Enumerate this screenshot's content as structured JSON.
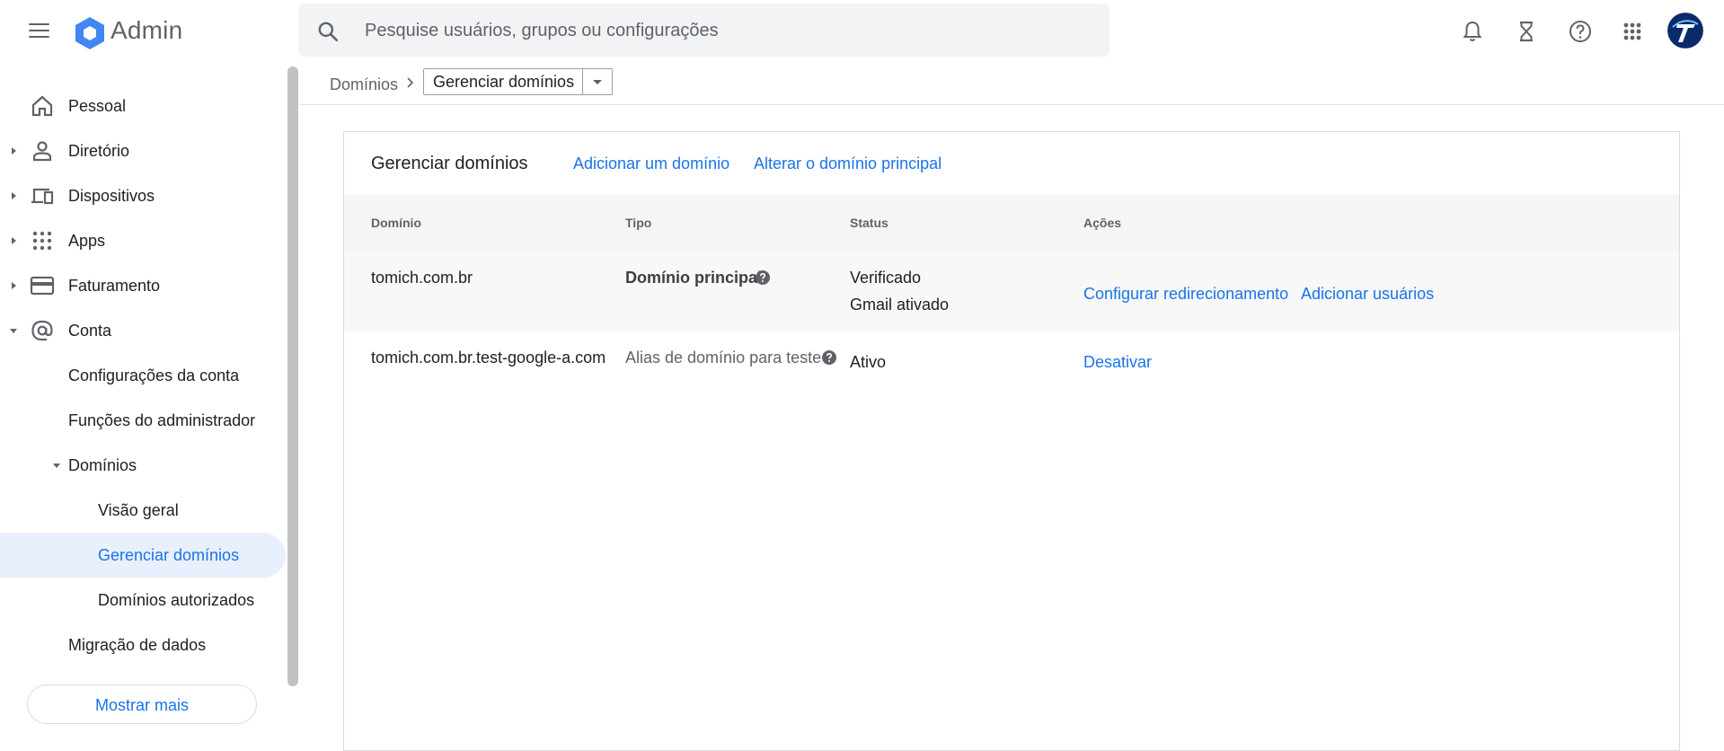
{
  "header": {
    "app_title": "Admin",
    "search_placeholder": "Pesquise usuários, grupos ou configurações",
    "icons": [
      "menu-icon",
      "admin-logo-icon",
      "search-icon",
      "bell-icon",
      "hourglass-icon",
      "help-icon",
      "apps-grid-icon",
      "avatar"
    ],
    "colors": {
      "logo": "#4285f4",
      "accent": "#1a73e8",
      "avatar_bg": "#0b2a6b"
    }
  },
  "sidebar": {
    "items": [
      {
        "label": "Pessoal",
        "icon": "home-icon"
      },
      {
        "label": "Diretório",
        "icon": "person-icon"
      },
      {
        "label": "Dispositivos",
        "icon": "devices-icon"
      },
      {
        "label": "Apps",
        "icon": "apps-icon"
      },
      {
        "label": "Faturamento",
        "icon": "credit-card-icon"
      },
      {
        "label": "Conta",
        "icon": "at-sign-icon"
      },
      {
        "label": "Configurações da conta"
      },
      {
        "label": "Funções do administrador"
      },
      {
        "label": "Domínios"
      },
      {
        "label": "Visão geral"
      },
      {
        "label": "Gerenciar domínios"
      },
      {
        "label": "Domínios autorizados"
      },
      {
        "label": "Migração de dados"
      }
    ],
    "show_more": "Mostrar mais",
    "selected": "Gerenciar domínios"
  },
  "breadcrumb": {
    "parent": "Domínios",
    "current": "Gerenciar domínios"
  },
  "card": {
    "title": "Gerenciar domínios",
    "add_domain": "Adicionar um domínio",
    "change_primary": "Alterar o domínio principal",
    "columns": [
      "Domínio",
      "Tipo",
      "Status",
      "Ações"
    ],
    "rows": [
      {
        "domain": "tomich.com.br",
        "type": "Domínio principal",
        "status1": "Verificado",
        "status2": "Gmail ativado",
        "action1": "Configurar redirecionamento",
        "action2": "Adicionar usuários"
      },
      {
        "domain": "tomich.com.br.test-google-a.com",
        "type": "Alias de domínio para teste",
        "status1": "Ativo",
        "action1": "Desativar"
      }
    ]
  }
}
